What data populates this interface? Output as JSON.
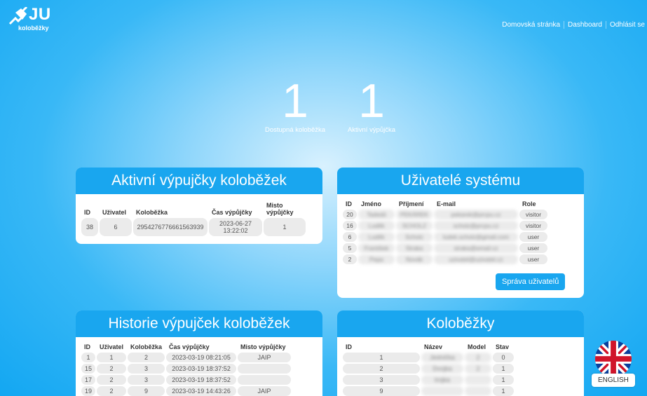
{
  "brand": {
    "name": "JU",
    "subtitle": "koloběžky"
  },
  "nav": {
    "home": "Domovská stránka",
    "dashboard": "Dashboard",
    "logout": "Odhlásit se"
  },
  "stats": [
    {
      "value": "1",
      "label": "Dostupná koloběžka"
    },
    {
      "value": "1",
      "label": "Aktivní výpůjčka"
    }
  ],
  "active_rentals": {
    "title": "Aktivní výpujčky koloběžek",
    "headers": [
      "ID",
      "Uživatel",
      "Koloběžka",
      "Čas výpůjčky",
      "Misto výpůjčky"
    ],
    "rows": [
      [
        "38",
        "6",
        "2954276776661563939",
        "2023-06-27 13:22:02",
        "1"
      ]
    ]
  },
  "users": {
    "title": "Uživatelé systému",
    "headers": [
      "ID",
      "Jméno",
      "Příjmení",
      "E-mail",
      "Role"
    ],
    "rows": [
      [
        "20",
        "Tadeáš",
        "PEKÁREK",
        "pekarek@prcpu.cz",
        "visitor"
      ],
      [
        "16",
        "Luděk",
        "SCHOLZ",
        "scholz@prcpu.cz",
        "visitor"
      ],
      [
        "6",
        "Luděk",
        "Scholz",
        "ludek.scholz@gmail.com",
        "user"
      ],
      [
        "5",
        "František",
        "Straka",
        "straka@email.cz",
        "user"
      ],
      [
        "2",
        "Pepa",
        "Novák",
        "uzivatel@uzivatel.cz",
        "user"
      ]
    ],
    "manage_button": "Správa uživatelů"
  },
  "history": {
    "title": "Historie výpujček koloběžek",
    "headers": [
      "ID",
      "Uživatel",
      "Koloběžka",
      "Čas výpůjčky",
      "Misto výpůjčky"
    ],
    "rows": [
      [
        "1",
        "1",
        "2",
        "2023-03-19 08:21:05",
        "JAIP"
      ],
      [
        "15",
        "2",
        "3",
        "2023-03-19 18:37:52",
        ""
      ],
      [
        "17",
        "2",
        "3",
        "2023-03-19 18:37:52",
        ""
      ],
      [
        "19",
        "2",
        "9",
        "2023-03-19 14:43:26",
        "JAIP"
      ]
    ]
  },
  "scooters": {
    "title": "Koloběžky",
    "headers": [
      "ID",
      "Název",
      "Model",
      "Stav"
    ],
    "rows": [
      [
        "1",
        "Jednička",
        "2",
        "0"
      ],
      [
        "2",
        "Dvojka",
        "2",
        "1"
      ],
      [
        "3",
        "trojka",
        "",
        "1"
      ],
      [
        "9",
        "",
        "",
        "1"
      ]
    ]
  },
  "language": {
    "label": "ENGLISH",
    "flag_icon": "uk-flag-icon"
  },
  "colors": {
    "accent": "#19a6ef",
    "background": "#39b8f6"
  }
}
